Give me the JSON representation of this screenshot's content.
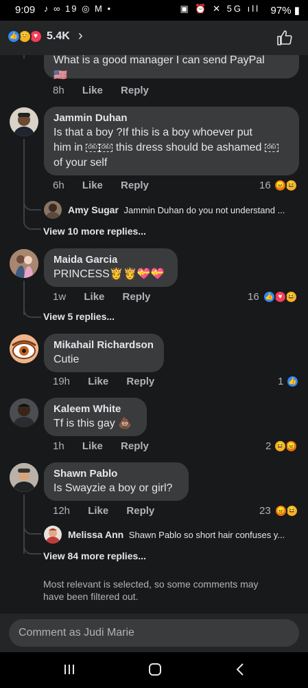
{
  "status_bar": {
    "time": "9:09",
    "battery": "97%",
    "left_icons": "♪ ∞ 19 ◎ M •",
    "right_icons": "▣ ⏰ ✕ 5G ıll"
  },
  "header": {
    "reaction_count": "5.4K"
  },
  "comments": [
    {
      "name": "",
      "text": "What is a good manager I can send PayPal",
      "flag": "🇺🇸",
      "time": "8h",
      "like": "Like",
      "reply": "Reply"
    },
    {
      "name": "Jammin Duhan",
      "text_lines": [
        "Is that a boy ?If this is a boy whoever put",
        "him in",
        "this dress should be ashamed",
        "of your self"
      ],
      "obj": "OBJ",
      "time": "6h",
      "like": "Like",
      "reply": "Reply",
      "reactions": "16",
      "reply_preview": {
        "name": "Amy Sugar",
        "text": "Jammin Duhan do you not understand ..."
      },
      "view_more": "View 10 more replies..."
    },
    {
      "name": "Maida Garcia",
      "text": "PRINCESS👸👸💝💝",
      "time": "1w",
      "like": "Like",
      "reply": "Reply",
      "reactions": "16",
      "view_more": "View 5 replies..."
    },
    {
      "name": "Mikahail Richardson",
      "text": "Cutie",
      "time": "19h",
      "like": "Like",
      "reply": "Reply",
      "reactions": "1"
    },
    {
      "name": "Kaleem White",
      "text": "Tf is this gay 💩",
      "time": "1h",
      "like": "Like",
      "reply": "Reply",
      "reactions": "2"
    },
    {
      "name": "Shawn Pablo",
      "text": "Is Swayzie a boy or girl?",
      "time": "12h",
      "like": "Like",
      "reply": "Reply",
      "reactions": "23",
      "reply_preview": {
        "name": "Melissa Ann",
        "text": "Shawn Pablo so short hair confuses y..."
      },
      "view_more": "View 84 more replies..."
    }
  ],
  "notice": "Most relevant is selected, so some comments may have been filtered out.",
  "composer": {
    "placeholder": "Comment as Judi Marie"
  },
  "colors": {
    "background": "#18191a",
    "bubble": "#3a3b3c",
    "like_blue": "#2d88ff",
    "haha_yellow": "#f7b125",
    "love_red": "#f33e58"
  }
}
